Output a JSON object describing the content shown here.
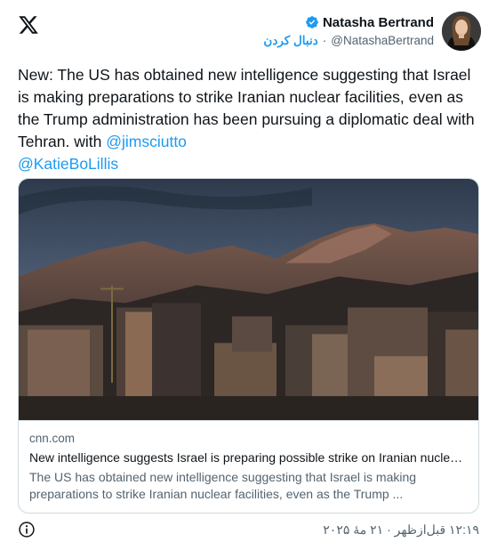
{
  "author": {
    "display_name": "Natasha Bertrand",
    "handle": "@NatashaBertrand",
    "follow_label": "دنبال کردن",
    "separator": "·",
    "verified_icon": "verified-badge-icon",
    "verified_color": "#1d9bf0"
  },
  "logo_icon": "x-logo-icon",
  "tweet": {
    "text": "New: The US has obtained new intelligence suggesting that Israel is making preparations to strike Iranian nuclear facilities, even as the Trump administration has been pursuing a diplomatic deal with Tehran. with ",
    "mention_1": "@jimsciutto",
    "mention_2": "@KatieBoLillis"
  },
  "card": {
    "domain": "cnn.com",
    "title": "New intelligence suggests Israel is preparing possible strike on Iranian nuclear...",
    "description": "The US has obtained new intelligence suggesting that Israel is making preparations to strike Iranian nuclear facilities, even as the Trump ..."
  },
  "footer": {
    "timestamp": "۱۲:۱۹ قبل‌ازظهر · ۲۱ مهٔ ۲۰۲۵",
    "info_icon": "info-icon"
  },
  "colors": {
    "accent": "#1d9bf0",
    "text_primary": "#0f1419",
    "text_secondary": "#536471",
    "border": "#cfd9de"
  }
}
